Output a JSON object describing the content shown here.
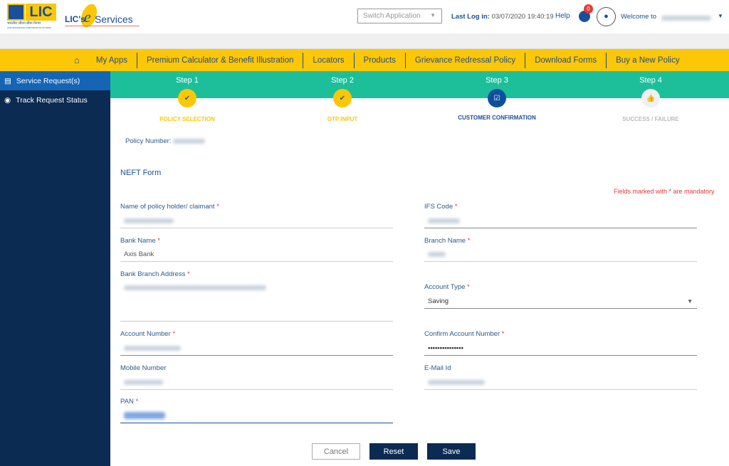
{
  "header": {
    "logo_text": "LIC",
    "logo_sub": "भारतीय जीवन बीमा निगम",
    "logo_sub2": "LIFE INSURANCE CORPORATION OF INDIA",
    "eservices_prefix": "LIC's",
    "eservices_e": "e",
    "eservices_suffix": "Services",
    "switch_app_placeholder": "Switch Application",
    "last_login_label": "Last Log in:",
    "last_login_value": "03/07/2020 19:40:19",
    "help": "Help",
    "notification_count": "0",
    "welcome": "Welcome to"
  },
  "nav": {
    "items": [
      "My Apps",
      "Premium Calculator & Benefit Illustration",
      "Locators",
      "Products",
      "Grievance Redressal Policy",
      "Download Forms",
      "Buy a New Policy"
    ]
  },
  "sidebar": {
    "items": [
      {
        "label": "Service Request(s)",
        "active": true
      },
      {
        "label": "Track Request Status",
        "active": false
      }
    ]
  },
  "steps": [
    {
      "title": "Step 1",
      "label": "POLICY SELECTION",
      "state": "done"
    },
    {
      "title": "Step 2",
      "label": "OTP INPUT",
      "state": "done"
    },
    {
      "title": "Step 3",
      "label": "CUSTOMER CONFIRMATION",
      "state": "active"
    },
    {
      "title": "Step 4",
      "label": "SUCCESS / FAILURE",
      "state": "pending"
    }
  ],
  "form": {
    "policy_number_label": "Policy Number:",
    "title": "NEFT Form",
    "mandatory_note": "Fields marked with * are mandatory",
    "fields": {
      "holder": {
        "label": "Name of policy holder/ claimant",
        "req": "*"
      },
      "ifsc": {
        "label": "IFS Code",
        "req": "*"
      },
      "bank": {
        "label": "Bank Name",
        "req": "*",
        "value": "Axis Bank"
      },
      "branch": {
        "label": "Branch Name",
        "req": "*"
      },
      "address": {
        "label": "Bank Branch Address",
        "req": "*"
      },
      "acct_type": {
        "label": "Account Type",
        "req": "*",
        "value": "Saving"
      },
      "acct_no": {
        "label": "Account Number",
        "req": "*"
      },
      "confirm_acct": {
        "label": "Confirm Account Number",
        "req": "*",
        "value": "•••••••••••••••"
      },
      "mobile": {
        "label": "Mobile Number"
      },
      "email": {
        "label": "E-Mail Id"
      },
      "pan": {
        "label": "PAN",
        "req": "*"
      }
    },
    "buttons": {
      "cancel": "Cancel",
      "reset": "Reset",
      "save": "Save"
    }
  },
  "colors": {
    "nav": "#fcc707",
    "sidebar": "#0c2b52",
    "steps": "#1dbf9b",
    "primary": "#0c2b52",
    "done": "#fcc707",
    "active": "#0d4f9c"
  }
}
